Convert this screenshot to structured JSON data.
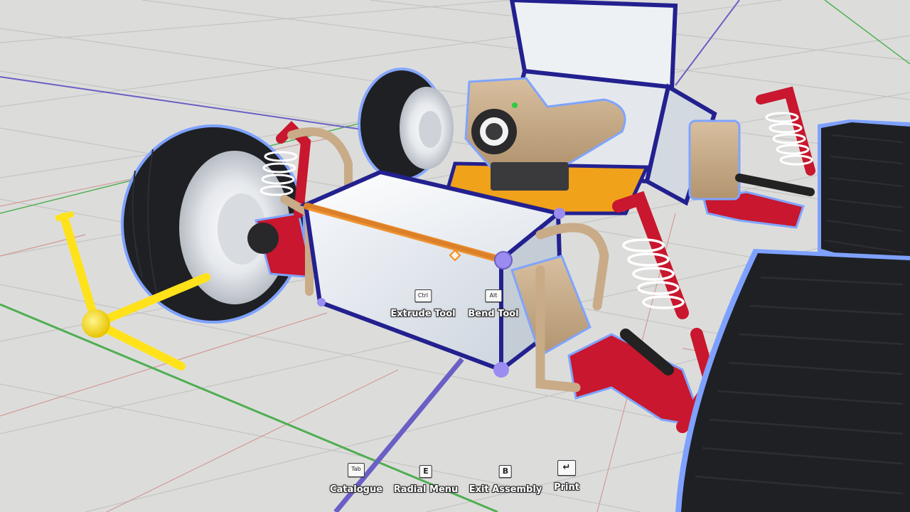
{
  "scene": {
    "description_colors": {
      "ground": "#dcdddb",
      "grid_line": "#bfc1bf",
      "axis_red": "#c97a7a",
      "axis_green": "#4fae52",
      "axis_blue": "#6a5fc4",
      "frame_outline": "#23208f",
      "selection_glow": "#7fa4ff",
      "selected_edge": "#f08a1e",
      "suspension_red": "#c8172e",
      "spring_white": "#ffffff",
      "tan_parts": "#c9ab88",
      "tyre": "#1e1f22",
      "rim": "#e6e9ee",
      "floor_orange": "#f0a21a",
      "gizmo_yellow": "#ffe21a"
    }
  },
  "tool_hints": [
    {
      "key": "Ctrl",
      "label": "Extrude Tool"
    },
    {
      "key": "Alt",
      "label": "Bend Tool"
    }
  ],
  "bottom_hints": [
    {
      "key": "Tab",
      "label": "Catalogue"
    },
    {
      "key": "E",
      "label": "Radial Menu"
    },
    {
      "key": "B",
      "label": "Exit Assembly"
    },
    {
      "key": "↵",
      "label": "Print"
    }
  ]
}
